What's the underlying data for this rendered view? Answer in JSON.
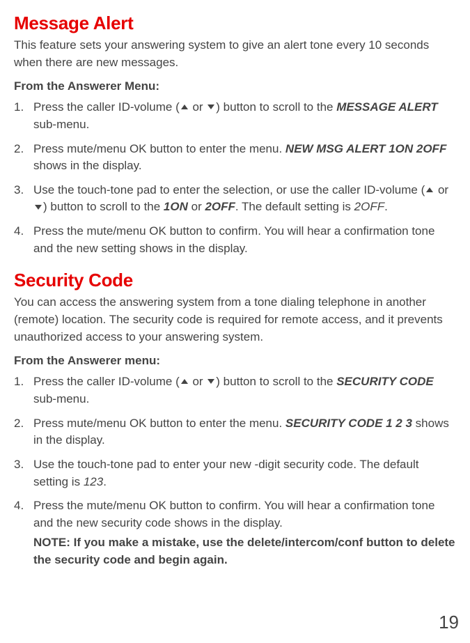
{
  "sections": {
    "messageAlert": {
      "title": "Message Alert",
      "intro": "This feature sets your answering system to give an alert tone every 10 seconds when there are new messages.",
      "sub": "From the Answerer Menu:",
      "steps": {
        "s1a": "Press the caller ID-volume (",
        "s1b": " or ",
        "s1c": ") button to scroll to the ",
        "s1d": "MESSAGE ALERT",
        "s1e": " sub-menu.",
        "s2a": "Press mute/menu OK button to enter the menu. ",
        "s2b": "NEW MSG ALERT 1ON 2OFF",
        "s2c": " shows in the display.",
        "s3a": "Use the touch-tone pad to enter the selection, or use the caller ID-volume (",
        "s3b": " or ",
        "s3c": ") button to scroll to the ",
        "s3d": "1ON",
        "s3e": " or ",
        "s3f": "2OFF",
        "s3g": ". The default setting is ",
        "s3h": "2OFF",
        "s3i": ".",
        "s4": "Press the mute/menu OK button to confirm. You will hear a confirmation tone and the new setting shows in the display."
      }
    },
    "securityCode": {
      "title": "Security Code",
      "intro": "You can access the answering system from a tone dialing telephone in another (remote) location. The security code is required for remote access, and it prevents unauthorized access to your answering system.",
      "sub": "From the Answerer menu:",
      "steps": {
        "s1a": "Press the caller ID-volume (",
        "s1b": " or ",
        "s1c": ") button to scroll to the ",
        "s1d": "SECURITY CODE",
        "s1e": " sub-menu.",
        "s2a": "Press mute/menu OK button to enter the menu. ",
        "s2b": "SECURITY CODE 1 2 3",
        "s2c": " shows in the display.",
        "s3a": "Use the touch-tone pad to enter your new -digit security code. The default setting is ",
        "s3b": "123",
        "s3c": ".",
        "s4": "Press the mute/menu OK button to confirm. You will hear a confirmation tone and the new security code shows in the display."
      },
      "note": "NOTE: If you make a mistake, use the delete/intercom/conf button to delete the security code and begin again."
    }
  },
  "pageNumber": "19"
}
